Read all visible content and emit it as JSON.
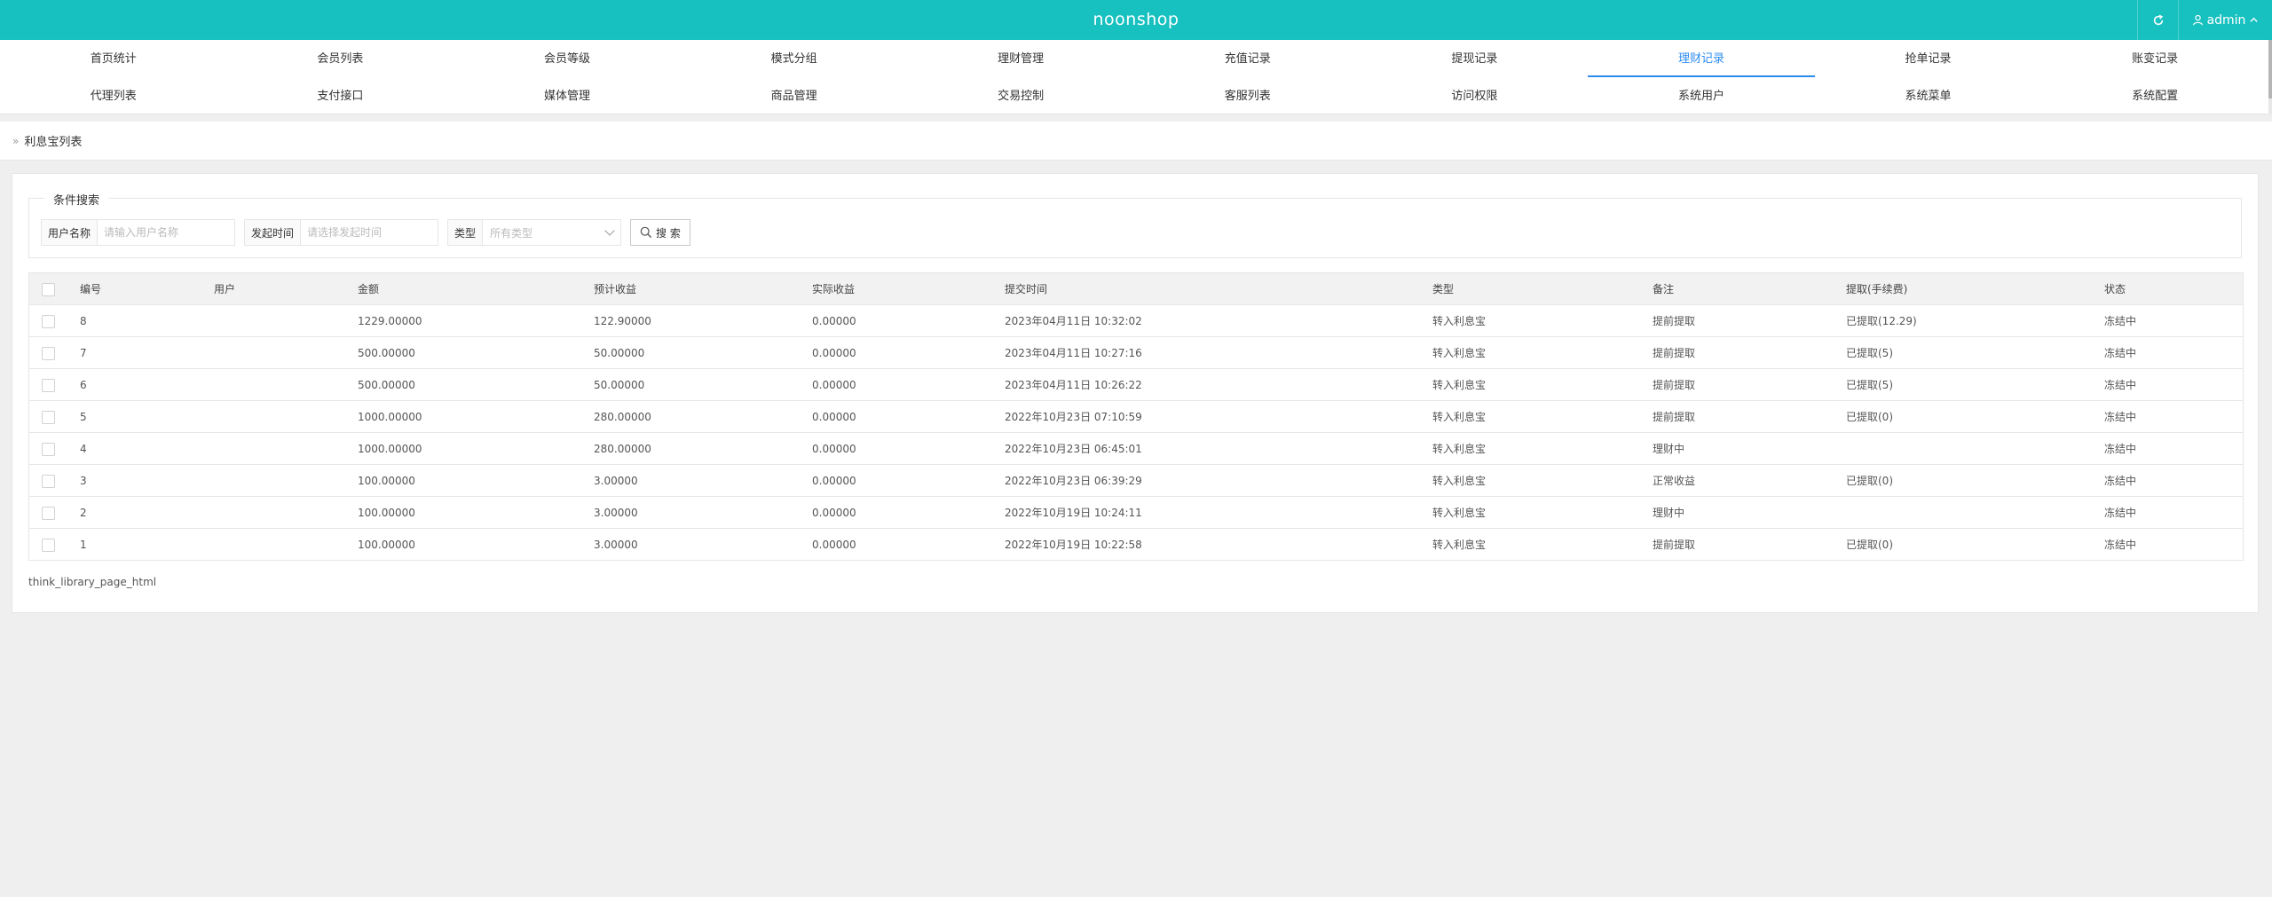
{
  "header": {
    "title": "noonshop",
    "user": "admin"
  },
  "nav": {
    "row1": [
      "首页统计",
      "会员列表",
      "会员等级",
      "模式分组",
      "理财管理",
      "充值记录",
      "提现记录",
      "理财记录",
      "抢单记录",
      "账变记录"
    ],
    "row2": [
      "代理列表",
      "支付接口",
      "媒体管理",
      "商品管理",
      "交易控制",
      "客服列表",
      "访问权限",
      "系统用户",
      "系统菜单",
      "系统配置"
    ],
    "active": "理财记录"
  },
  "breadcrumb": {
    "separator": "»",
    "current": "利息宝列表"
  },
  "search": {
    "legend": "条件搜索",
    "username_label": "用户名称",
    "username_placeholder": "请输入用户名称",
    "time_label": "发起时间",
    "time_placeholder": "请选择发起时间",
    "type_label": "类型",
    "type_value": "所有类型",
    "search_button": "搜 索"
  },
  "table": {
    "columns": [
      "编号",
      "用户",
      "金额",
      "预计收益",
      "实际收益",
      "提交时间",
      "类型",
      "备注",
      "提取(手续费)",
      "状态"
    ],
    "rows": [
      [
        "8",
        "",
        "1229.00000",
        "122.90000",
        "0.00000",
        "2023年04月11日 10:32:02",
        "转入利息宝",
        "提前提取",
        "已提取(12.29)",
        "冻结中"
      ],
      [
        "7",
        "",
        "500.00000",
        "50.00000",
        "0.00000",
        "2023年04月11日 10:27:16",
        "转入利息宝",
        "提前提取",
        "已提取(5)",
        "冻结中"
      ],
      [
        "6",
        "",
        "500.00000",
        "50.00000",
        "0.00000",
        "2023年04月11日 10:26:22",
        "转入利息宝",
        "提前提取",
        "已提取(5)",
        "冻结中"
      ],
      [
        "5",
        "",
        "1000.00000",
        "280.00000",
        "0.00000",
        "2022年10月23日 07:10:59",
        "转入利息宝",
        "提前提取",
        "已提取(0)",
        "冻结中"
      ],
      [
        "4",
        "",
        "1000.00000",
        "280.00000",
        "0.00000",
        "2022年10月23日 06:45:01",
        "转入利息宝",
        "理财中",
        "",
        "冻结中"
      ],
      [
        "3",
        "",
        "100.00000",
        "3.00000",
        "0.00000",
        "2022年10月23日 06:39:29",
        "转入利息宝",
        "正常收益",
        "已提取(0)",
        "冻结中"
      ],
      [
        "2",
        "",
        "100.00000",
        "3.00000",
        "0.00000",
        "2022年10月19日 10:24:11",
        "转入利息宝",
        "理财中",
        "",
        "冻结中"
      ],
      [
        "1",
        "",
        "100.00000",
        "3.00000",
        "0.00000",
        "2022年10月19日 10:22:58",
        "转入利息宝",
        "提前提取",
        "已提取(0)",
        "冻结中"
      ]
    ]
  },
  "footer": {
    "pagination_text": "think_library_page_html"
  },
  "colors": {
    "header_bg": "#17c1c0",
    "active_tab": "#2d8cf0",
    "page_bg": "#efeff0"
  }
}
